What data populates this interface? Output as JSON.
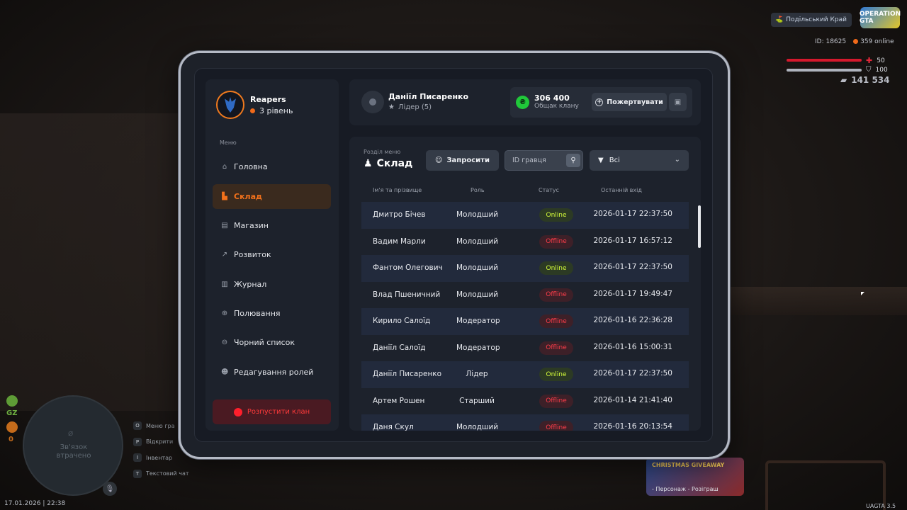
{
  "hud": {
    "server": "Подільський Край",
    "logo": "OPERATION GTA",
    "id": "ID: 18625",
    "online": "359 online",
    "health": "50",
    "armor": "100",
    "money": "141 534",
    "gz": "GZ",
    "wanted": "0",
    "minimap_status": "Зв'язок втрачено",
    "hotkeys": [
      {
        "key": "O",
        "label": "Меню гра"
      },
      {
        "key": "P",
        "label": "Відкрити"
      },
      {
        "key": "I",
        "label": "Інвентар"
      },
      {
        "key": "T",
        "label": "Текстовий чат"
      }
    ],
    "datetime": "17.01.2026 | 22:38",
    "version": "UAGTA 3.5",
    "promo_title": "CHRISTMAS GIVEAWAY",
    "promo_sub": "- Персонаж - Розіграш"
  },
  "clan": {
    "name": "Reapers",
    "level": "3 рівень"
  },
  "menu": {
    "label": "Меню",
    "items": [
      {
        "label": "Головна",
        "icon": "home-icon"
      },
      {
        "label": "Склад",
        "icon": "warehouse-icon",
        "active": true
      },
      {
        "label": "Магазин",
        "icon": "shop-icon"
      },
      {
        "label": "Розвиток",
        "icon": "chart-icon"
      },
      {
        "label": "Журнал",
        "icon": "book-icon"
      },
      {
        "label": "Полювання",
        "icon": "crosshair-icon"
      },
      {
        "label": "Чорний список",
        "icon": "blacklist-icon"
      },
      {
        "label": "Редагування ролей",
        "icon": "user-edit-icon"
      }
    ],
    "disband": "Розпустити клан"
  },
  "header": {
    "player_name": "Даніїл Писаренко",
    "player_role": "Лідер (5)",
    "balance": "306 400",
    "balance_label": "Общак клану",
    "donate": "Пожертвувати"
  },
  "section": {
    "label": "Розділ меню",
    "title": "Склад",
    "invite": "Запросити",
    "search_placeholder": "ID гравця",
    "filter": "Всі"
  },
  "table": {
    "columns": [
      "Ім'я та прізвище",
      "Роль",
      "Статус",
      "Останній вхід"
    ],
    "rows": [
      {
        "name": "Дмитро Бічев",
        "role": "Молодший",
        "status": "Online",
        "last": "2026-01-17 22:37:50"
      },
      {
        "name": "Вадим Марли",
        "role": "Молодший",
        "status": "Offline",
        "last": "2026-01-17 16:57:12"
      },
      {
        "name": "Фантом Олегович",
        "role": "Молодший",
        "status": "Online",
        "last": "2026-01-17 22:37:50"
      },
      {
        "name": "Влад Пшеничний",
        "role": "Молодший",
        "status": "Offline",
        "last": "2026-01-17 19:49:47"
      },
      {
        "name": "Кирило Салоїд",
        "role": "Модератор",
        "status": "Offline",
        "last": "2026-01-16 22:36:28"
      },
      {
        "name": "Даніїл Салоїд",
        "role": "Модератор",
        "status": "Offline",
        "last": "2026-01-16 15:00:31"
      },
      {
        "name": "Даніїл Писаренко",
        "role": "Лідер",
        "status": "Online",
        "last": "2026-01-17 22:37:50"
      },
      {
        "name": "Артем Рошен",
        "role": "Старший",
        "status": "Offline",
        "last": "2026-01-14 21:41:40"
      },
      {
        "name": "Даня Скул",
        "role": "Молодший",
        "status": "Offline",
        "last": "2026-01-16 20:13:54"
      }
    ]
  },
  "colors": {
    "accent": "#f2711b",
    "online": "#d7ff3a",
    "offline": "#ff3d4a",
    "danger": "#ff1f2c"
  }
}
